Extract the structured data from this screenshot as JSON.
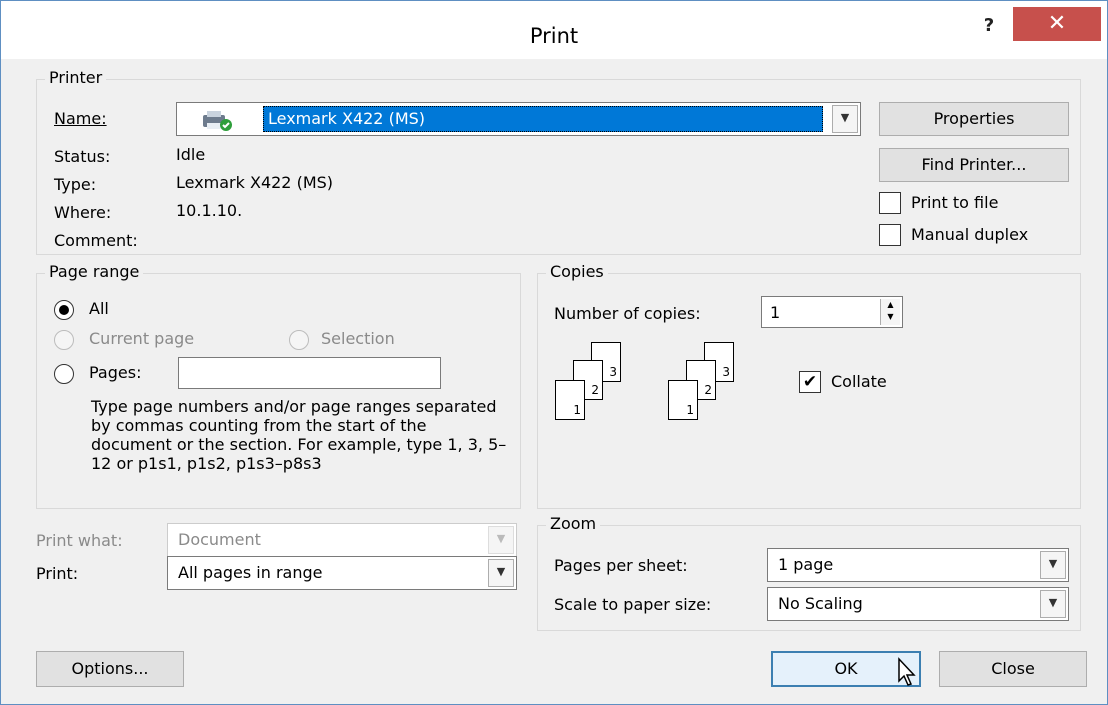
{
  "window": {
    "title": "Print",
    "help_icon": "?",
    "close_icon": "✕"
  },
  "printer": {
    "group_title": "Printer",
    "name_label": "Name:",
    "name_value": "Lexmark X422 (MS)",
    "status_label": "Status:",
    "status_value": "Idle",
    "type_label": "Type:",
    "type_value": "Lexmark X422 (MS)",
    "where_label": "Where:",
    "where_value": "10.1.10.",
    "comment_label": "Comment:",
    "properties_button": "Properties",
    "find_printer_button": "Find Printer...",
    "print_to_file_label": "Print to file",
    "manual_duplex_label": "Manual duplex",
    "print_to_file_checked": false,
    "manual_duplex_checked": false
  },
  "page_range": {
    "group_title": "Page range",
    "all_label": "All",
    "current_page_label": "Current page",
    "selection_label": "Selection",
    "pages_label": "Pages:",
    "pages_value": "",
    "selected": "All",
    "hint": "Type page numbers and/or page ranges separated by commas counting from the start of the document or the section. For example, type 1, 3, 5–12 or p1s1, p1s2, p1s3–p8s3"
  },
  "copies": {
    "group_title": "Copies",
    "number_label": "Number of copies:",
    "number_value": "1",
    "collate_label": "Collate",
    "collate_checked": true,
    "page_numbers": [
      "1",
      "2",
      "3"
    ]
  },
  "print_options": {
    "print_what_label": "Print what:",
    "print_what_value": "Document",
    "print_label": "Print:",
    "print_value": "All pages in range"
  },
  "zoom": {
    "group_title": "Zoom",
    "pages_per_sheet_label": "Pages per sheet:",
    "pages_per_sheet_value": "1 page",
    "scale_label": "Scale to paper size:",
    "scale_value": "No Scaling"
  },
  "footer": {
    "options_button": "Options...",
    "ok_button": "OK",
    "close_button": "Close"
  },
  "colors": {
    "selection_highlight": "#0078d7",
    "close_button_bg": "#c7504c",
    "window_border": "#5e8fc2"
  }
}
